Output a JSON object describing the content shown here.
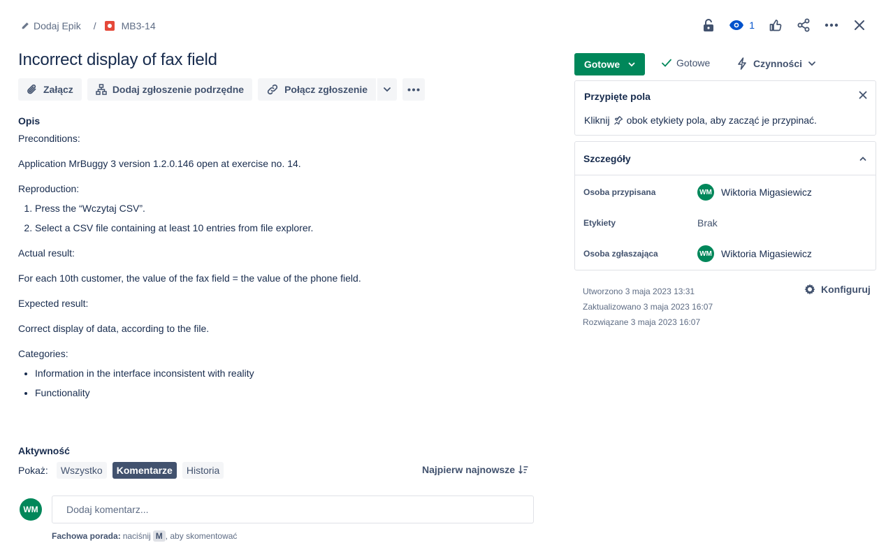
{
  "breadcrumb": {
    "add_epic": "Dodaj Epik",
    "separator": "/",
    "issue_key": "MB3-14"
  },
  "header": {
    "watchers_count": "1"
  },
  "issue": {
    "title": "Incorrect display of fax field"
  },
  "toolbar": {
    "attach": "Załącz",
    "add_child": "Dodaj zgłoszenie podrzędne",
    "link_issue": "Połącz zgłoszenie"
  },
  "description": {
    "label": "Opis",
    "preconditions_heading": "Preconditions:",
    "preconditions": "Application MrBuggy 3 version 1.2.0.146 open at exercise no. 14.",
    "reproduction_heading": "Reproduction:",
    "steps": [
      "Press the “Wczytaj CSV”.",
      "Select a CSV file containing at least 10 entries from file explorer."
    ],
    "actual_heading": "Actual result:",
    "actual": "For each 10th customer, the value of the fax field = the value of the phone field.",
    "expected_heading": "Expected result:",
    "expected": "Correct display of data, according to the file.",
    "categories_heading": "Categories:",
    "categories": [
      "Information in the interface inconsistent with reality",
      "Functionality"
    ]
  },
  "activity": {
    "label": "Aktywność",
    "show_label": "Pokaż:",
    "filters": [
      "Wszystko",
      "Komentarze",
      "Historia"
    ],
    "active_filter": "Komentarze",
    "sort_label": "Najpierw najnowsze",
    "comment_placeholder": "Dodaj komentarz...",
    "tip_bold": "Fachowa porada:",
    "tip_pre": "naciśnij",
    "tip_key": "M",
    "tip_post": ", aby skomentować",
    "user_initials": "WM"
  },
  "status": {
    "button_label": "Gotowe",
    "resolution": "Gotowe",
    "actions_label": "Czynności",
    "accent_color": "#00875a"
  },
  "pinned": {
    "title": "Przypięte pola",
    "text_before": "Kliknij",
    "text_after": "obok etykiety pola, aby zacząć je przypinać."
  },
  "details": {
    "title": "Szczegóły",
    "assignee_label": "Osoba przypisana",
    "assignee_name": "Wiktoria Migasiewicz",
    "assignee_initials": "WM",
    "labels_label": "Etykiety",
    "labels_value": "Brak",
    "reporter_label": "Osoba zgłaszająca",
    "reporter_name": "Wiktoria Migasiewicz",
    "reporter_initials": "WM"
  },
  "meta": {
    "created": "Utworzono 3 maja 2023 13:31",
    "updated": "Zaktualizowano 3 maja 2023 16:07",
    "resolved": "Rozwiązane 3 maja 2023 16:07",
    "configure": "Konfiguruj"
  }
}
